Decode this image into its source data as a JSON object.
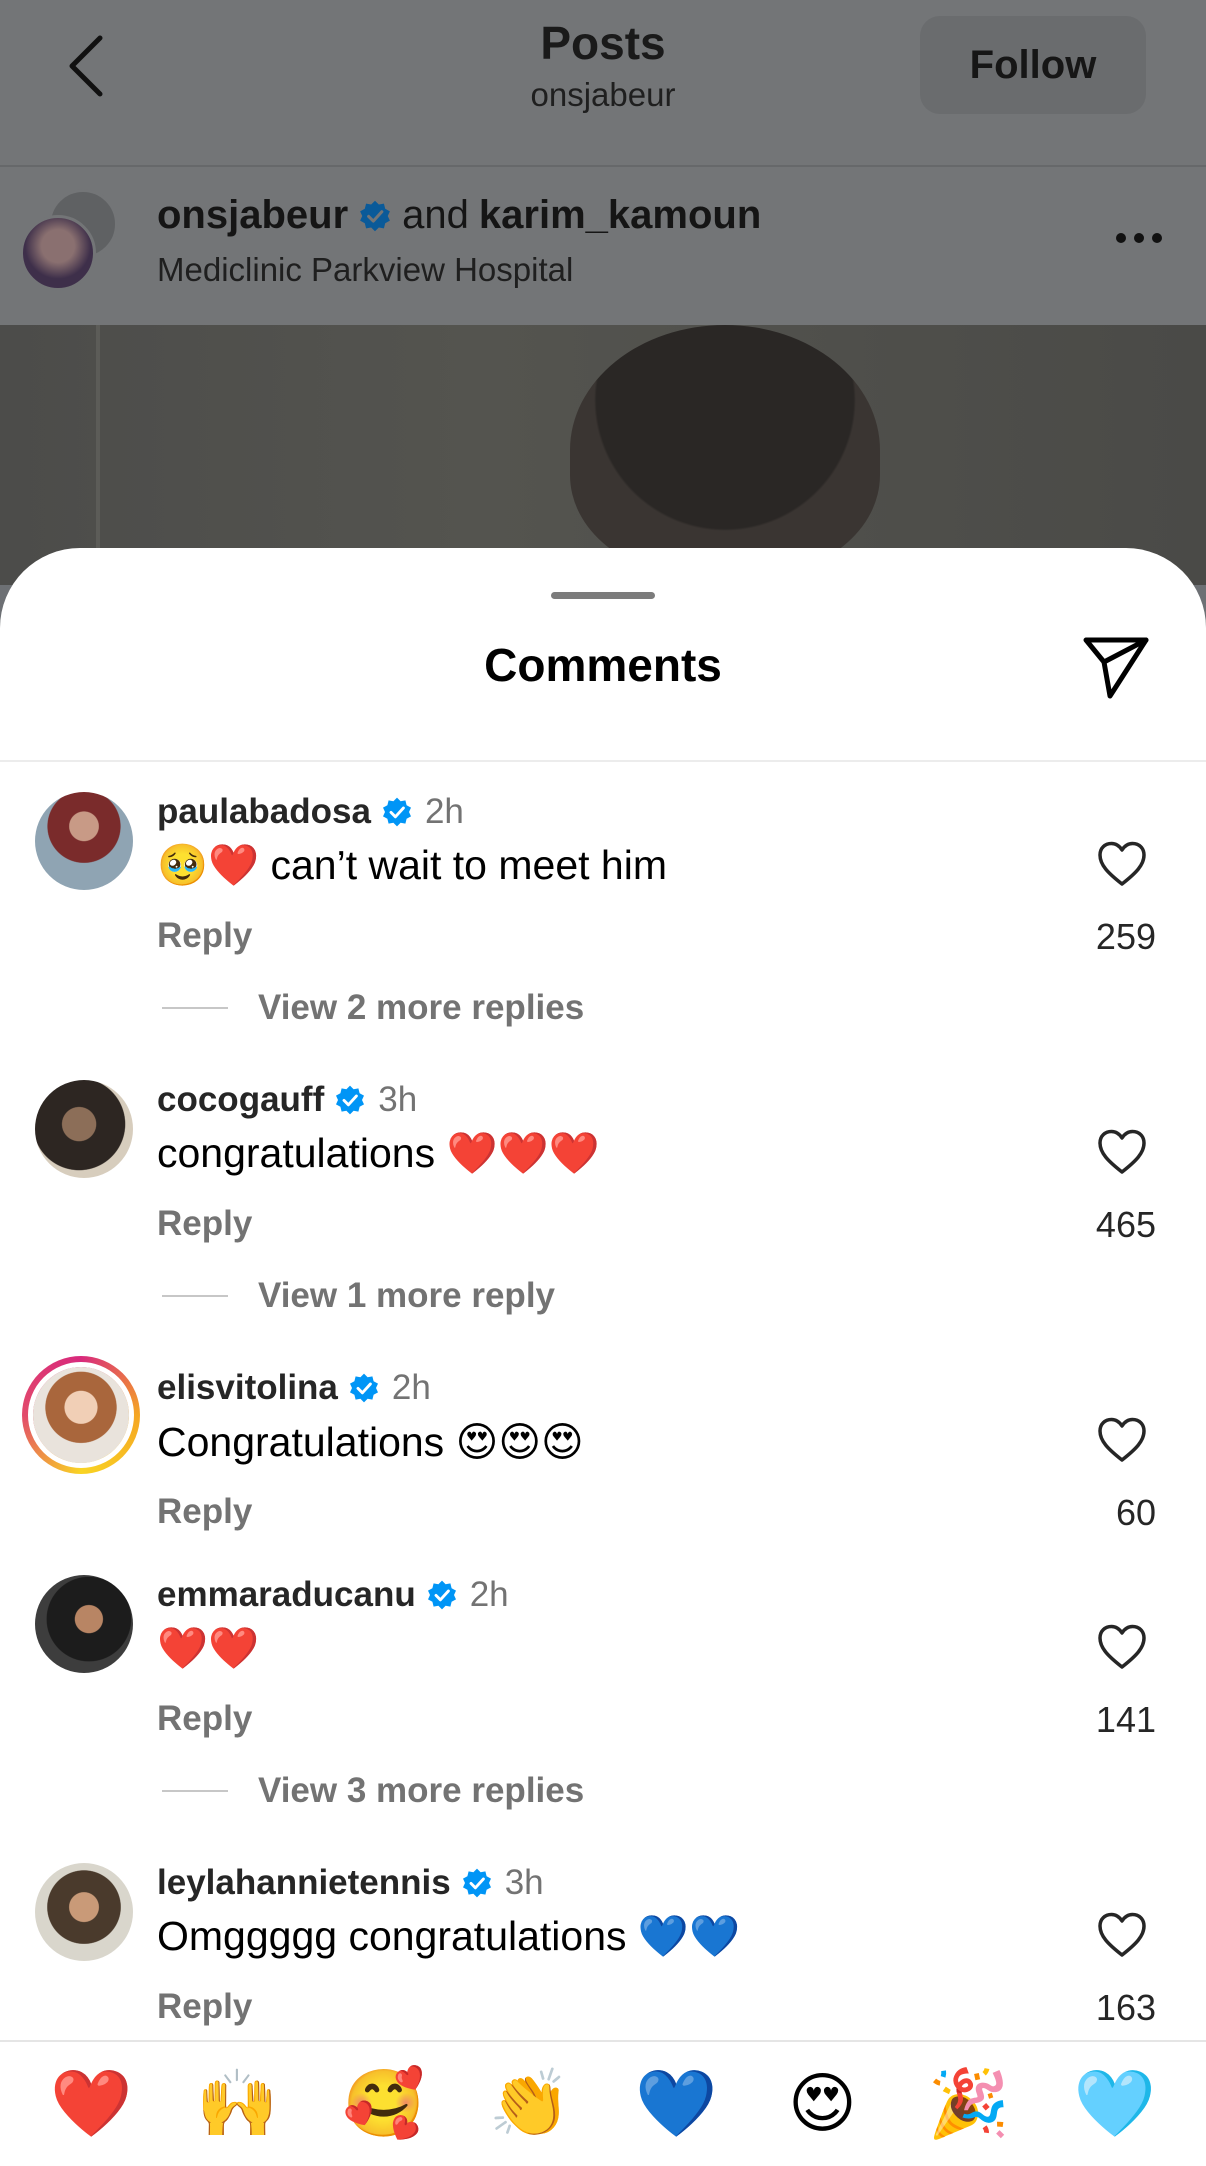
{
  "header": {
    "title": "Posts",
    "subtitle": "onsjabeur",
    "follow_label": "Follow"
  },
  "post": {
    "author": "onsjabeur",
    "and_text": "and",
    "coauthor": "karim_kamoun",
    "location": "Mediclinic Parkview Hospital"
  },
  "comments_sheet": {
    "title": "Comments"
  },
  "comments": [
    {
      "user": "paulabadosa",
      "verified": true,
      "time": "2h",
      "text": "🥹❤️ can’t wait to meet him",
      "reply_label": "Reply",
      "likes": "259",
      "more_replies": "View 2 more replies"
    },
    {
      "user": "cocogauff",
      "verified": true,
      "time": "3h",
      "text": "congratulations ❤️❤️❤️",
      "reply_label": "Reply",
      "likes": "465",
      "more_replies": "View 1 more reply"
    },
    {
      "user": "elisvitolina",
      "verified": true,
      "time": "2h",
      "text": "Congratulations 😍😍😍",
      "reply_label": "Reply",
      "likes": "60",
      "more_replies": ""
    },
    {
      "user": "emmaraducanu",
      "verified": true,
      "time": "2h",
      "text": "❤️❤️",
      "reply_label": "Reply",
      "likes": "141",
      "more_replies": "View 3 more replies"
    },
    {
      "user": "leylahannietennis",
      "verified": true,
      "time": "3h",
      "text": "Omggggg congratulations 💙💙",
      "reply_label": "Reply",
      "likes": "163",
      "more_replies": ""
    }
  ],
  "quick_reactions": [
    "❤️",
    "🙌",
    "🥰",
    "👏",
    "💙",
    "😍",
    "🎉",
    "🩵"
  ],
  "icons": {
    "back": "chevron-left-icon",
    "more": "more-horizontal-icon",
    "share": "paper-plane-icon",
    "verified": "verified-badge-icon",
    "like": "heart-outline-icon"
  },
  "colors": {
    "verified_blue": "#0095f6",
    "secondary_text": "#737373",
    "story_ring": "#d8297c"
  }
}
